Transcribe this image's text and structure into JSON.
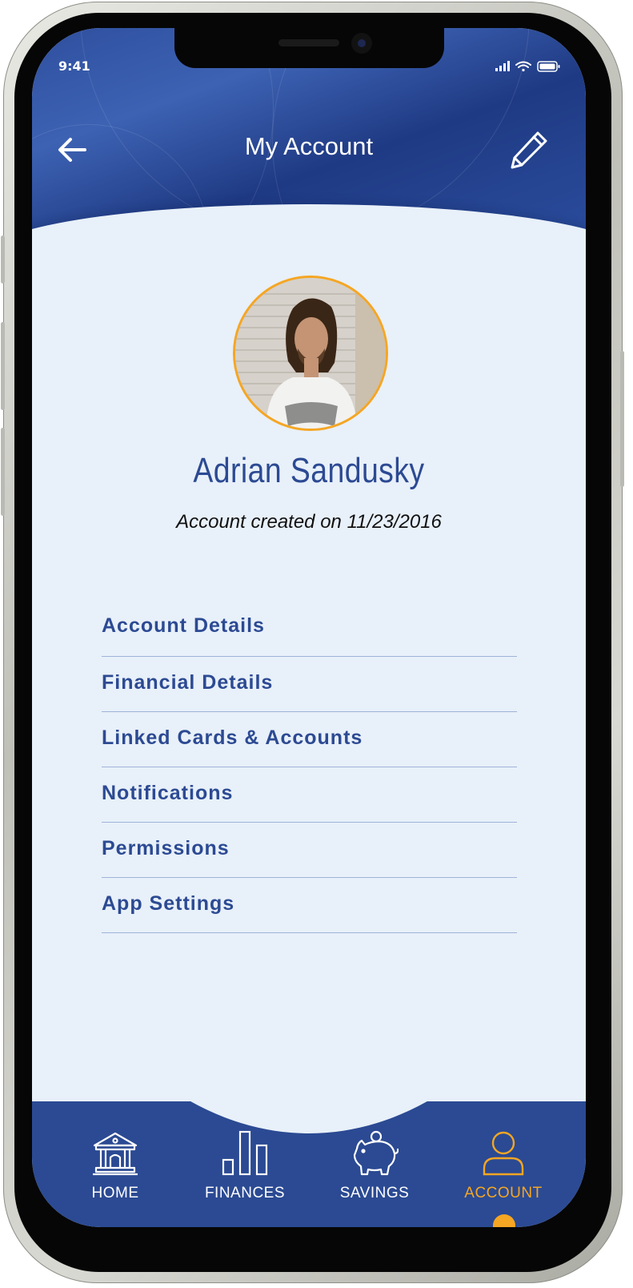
{
  "status_bar": {
    "time": "9:41"
  },
  "header": {
    "title": "My Account",
    "back_icon": "arrow-left-icon",
    "edit_icon": "pencil-icon"
  },
  "profile": {
    "name": "Adrian Sandusky",
    "created_text": "Account created on 11/23/2016"
  },
  "menu": [
    {
      "label": "Account Details"
    },
    {
      "label": "Financial Details"
    },
    {
      "label": "Linked Cards & Accounts"
    },
    {
      "label": "Notifications"
    },
    {
      "label": "Permissions"
    },
    {
      "label": "App Settings"
    }
  ],
  "nav": [
    {
      "label": "HOME",
      "icon": "bank-icon"
    },
    {
      "label": "FINANCES",
      "icon": "bar-chart-icon"
    },
    {
      "label": "SAVINGS",
      "icon": "piggy-bank-icon"
    },
    {
      "label": "ACCOUNT",
      "icon": "user-icon",
      "active": true
    }
  ],
  "colors": {
    "primary": "#2b4a93",
    "accent": "#f5a623",
    "background": "#e8f0f9"
  }
}
